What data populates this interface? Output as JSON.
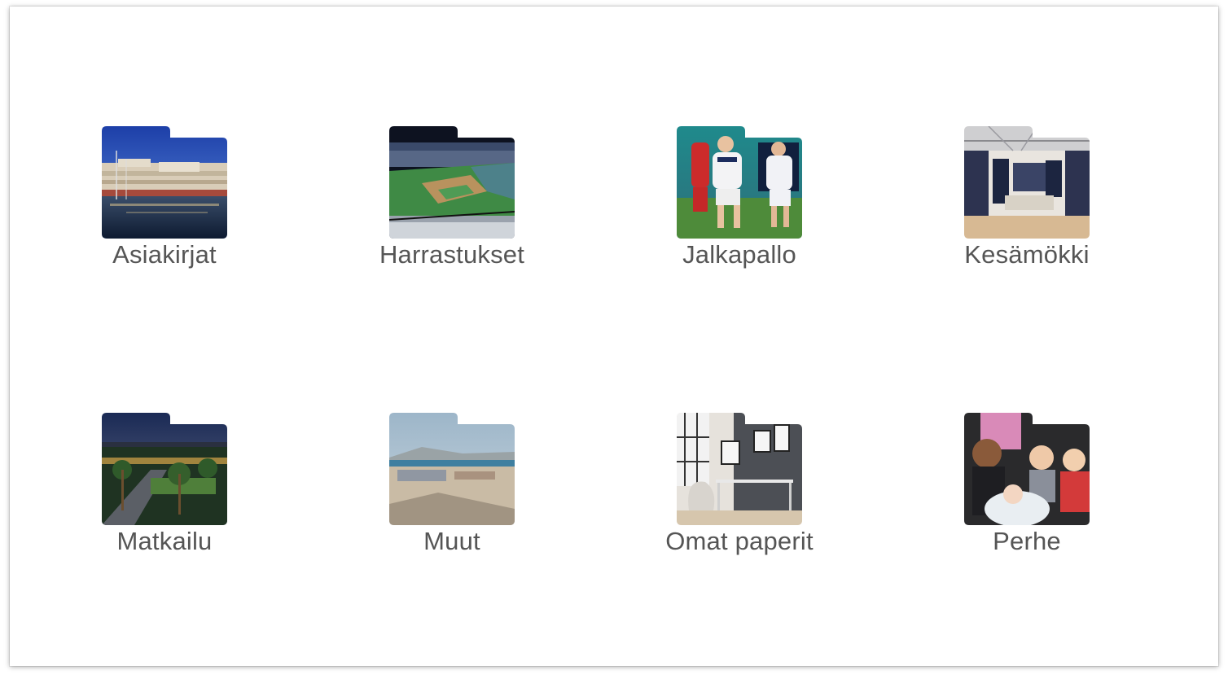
{
  "folders": [
    {
      "label": "Asiakirjat",
      "icon": "folder-icon",
      "thumbnail": "marina-photo"
    },
    {
      "label": "Harrastukset",
      "icon": "folder-icon",
      "thumbnail": "baseball-stadium-photo"
    },
    {
      "label": "Jalkapallo",
      "icon": "folder-icon",
      "thumbnail": "football-players-photo"
    },
    {
      "label": "Kesämökki",
      "icon": "folder-icon",
      "thumbnail": "shop-interior-photo"
    },
    {
      "label": "Matkailu",
      "icon": "folder-icon",
      "thumbnail": "palm-promenade-night-photo"
    },
    {
      "label": "Muut",
      "icon": "folder-icon",
      "thumbnail": "beach-photo"
    },
    {
      "label": "Omat paperit",
      "icon": "folder-icon",
      "thumbnail": "home-office-photo"
    },
    {
      "label": "Perhe",
      "icon": "folder-icon",
      "thumbnail": "family-children-photo"
    }
  ],
  "colors": {
    "label_text": "#555555",
    "background": "#ffffff"
  }
}
